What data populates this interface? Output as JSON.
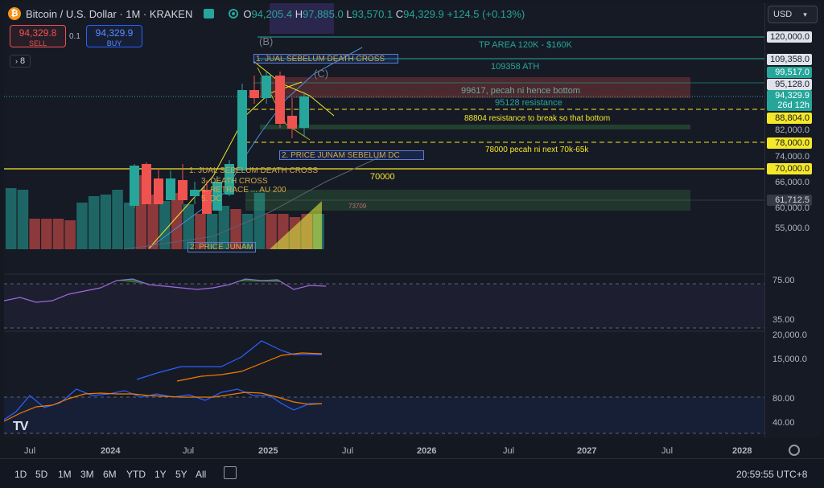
{
  "header": {
    "symbol": "Bitcoin / U.S. Dollar · 1M · KRAKEN",
    "btc_glyph": "₿",
    "open_label": "O",
    "open": "94,205.4",
    "high_label": "H",
    "high": "97,885.0",
    "low_label": "L",
    "low": "93,570.1",
    "close_label": "C",
    "close": "94,329.9",
    "change": "+124.5 (+0.13%)"
  },
  "trade": {
    "sell_price": "94,329.8",
    "sell_label": "SELL",
    "spread": "0.1",
    "buy_price": "94,329.9",
    "buy_label": "BUY",
    "indicators_count": "8"
  },
  "currency": "USD",
  "price_labels": [
    {
      "text": "120,000.0",
      "style": "white"
    },
    {
      "text": "109,358.0",
      "style": "white"
    },
    {
      "text": "99,517.0",
      "style": "teal"
    },
    {
      "text": "95,128.0",
      "style": "white"
    },
    {
      "text": "94,329.9",
      "style": "current"
    },
    {
      "text": "26d 12h",
      "style": "current"
    },
    {
      "text": "88,804.0",
      "style": "yellow"
    },
    {
      "text": "82,000.0",
      "style": "plain"
    },
    {
      "text": "78,000.0",
      "style": "yellow"
    },
    {
      "text": "74,000.0",
      "style": "plain"
    },
    {
      "text": "70,000.0",
      "style": "yellow"
    },
    {
      "text": "66,000.0",
      "style": "plain"
    },
    {
      "text": "61,712.5",
      "style": "grey"
    },
    {
      "text": "60,000.0",
      "style": "plain"
    },
    {
      "text": "55,000.0",
      "style": "plain"
    }
  ],
  "rsi_labels": [
    "75.00",
    "35.00"
  ],
  "macd_labels": [
    "20,000.0",
    "15,000.0",
    "80.00",
    "40.00"
  ],
  "time_axis": [
    "Jul",
    "2024",
    "Jul",
    "2025",
    "Jul",
    "2026",
    "Jul",
    "2027",
    "Jul",
    "2028"
  ],
  "ranges": [
    "1D",
    "5D",
    "1M",
    "3M",
    "6M",
    "YTD",
    "1Y",
    "5Y",
    "All"
  ],
  "clock": "20:59:55 UTC+8",
  "logo_text": "TV",
  "annotations": {
    "tp_area": "TP AREA 120K - $160K",
    "ath": "109358 ATH",
    "pecah": "99617, pecah ni hence bottom",
    "res95": "95128 resistance",
    "res88": "88804 resistance to break so that bottom",
    "note78": "78000 pecah ni next 70k-65k",
    "label70": "70000",
    "label73709": "73709",
    "jual1": "1. JUAL SEBELUM DEATH CROSS",
    "price2": "2. PRICE JUNAM SEBELUM DC",
    "jual_old": "1. JUAL SEBELUM DEATH CROSS",
    "dead_cross": "3. DEATH CROSS",
    "retrace": "4. RETRACE ... AU 200",
    "dc": "5. DC",
    "price_junam_old": "2. PRICE JUNAM",
    "wave_b": "(B)",
    "wave_c": "(C)"
  },
  "colors": {
    "teal": "#26a69a",
    "red": "#ef5350",
    "yellow": "#f5e829",
    "blue": "#2962ff",
    "orange": "#f57c00",
    "purple": "#9c6ade"
  }
}
